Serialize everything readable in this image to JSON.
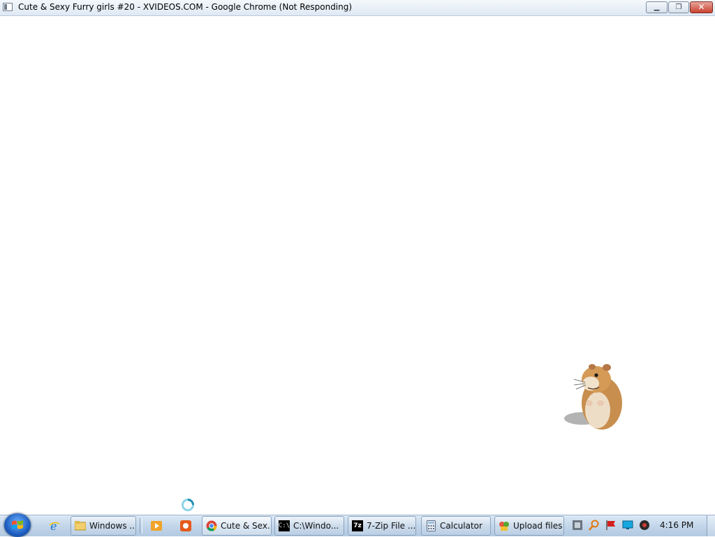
{
  "window": {
    "title": "Cute & Sexy Furry girls #20 - XVIDEOS.COM - Google Chrome (Not Responding)",
    "minimize_label": "▁",
    "restore_label": "❐",
    "close_label": "✕"
  },
  "taskbar": {
    "buttons": [
      {
        "label": "Windows ...",
        "icon": "folder-icon"
      },
      {
        "label": "Cute & Sex...",
        "icon": "chrome-icon",
        "active": true
      },
      {
        "label": "C:\\Windo...",
        "icon": "cmd-icon"
      },
      {
        "label": "7-Zip File ...",
        "icon": "7zip-icon"
      },
      {
        "label": "Calculator",
        "icon": "calculator-icon"
      },
      {
        "label": "Upload files",
        "icon": "upload-icon"
      }
    ],
    "quick_launch": [
      "internet-explorer-icon",
      "media-player-icon",
      "app-icon"
    ],
    "tray_icons": [
      "network-icon",
      "search-icon",
      "flag-icon",
      "display-icon",
      "volume-icon"
    ],
    "clock": "4:16 PM",
    "cmd_icon_text": "C:\\",
    "zip_icon_text": "7z"
  }
}
